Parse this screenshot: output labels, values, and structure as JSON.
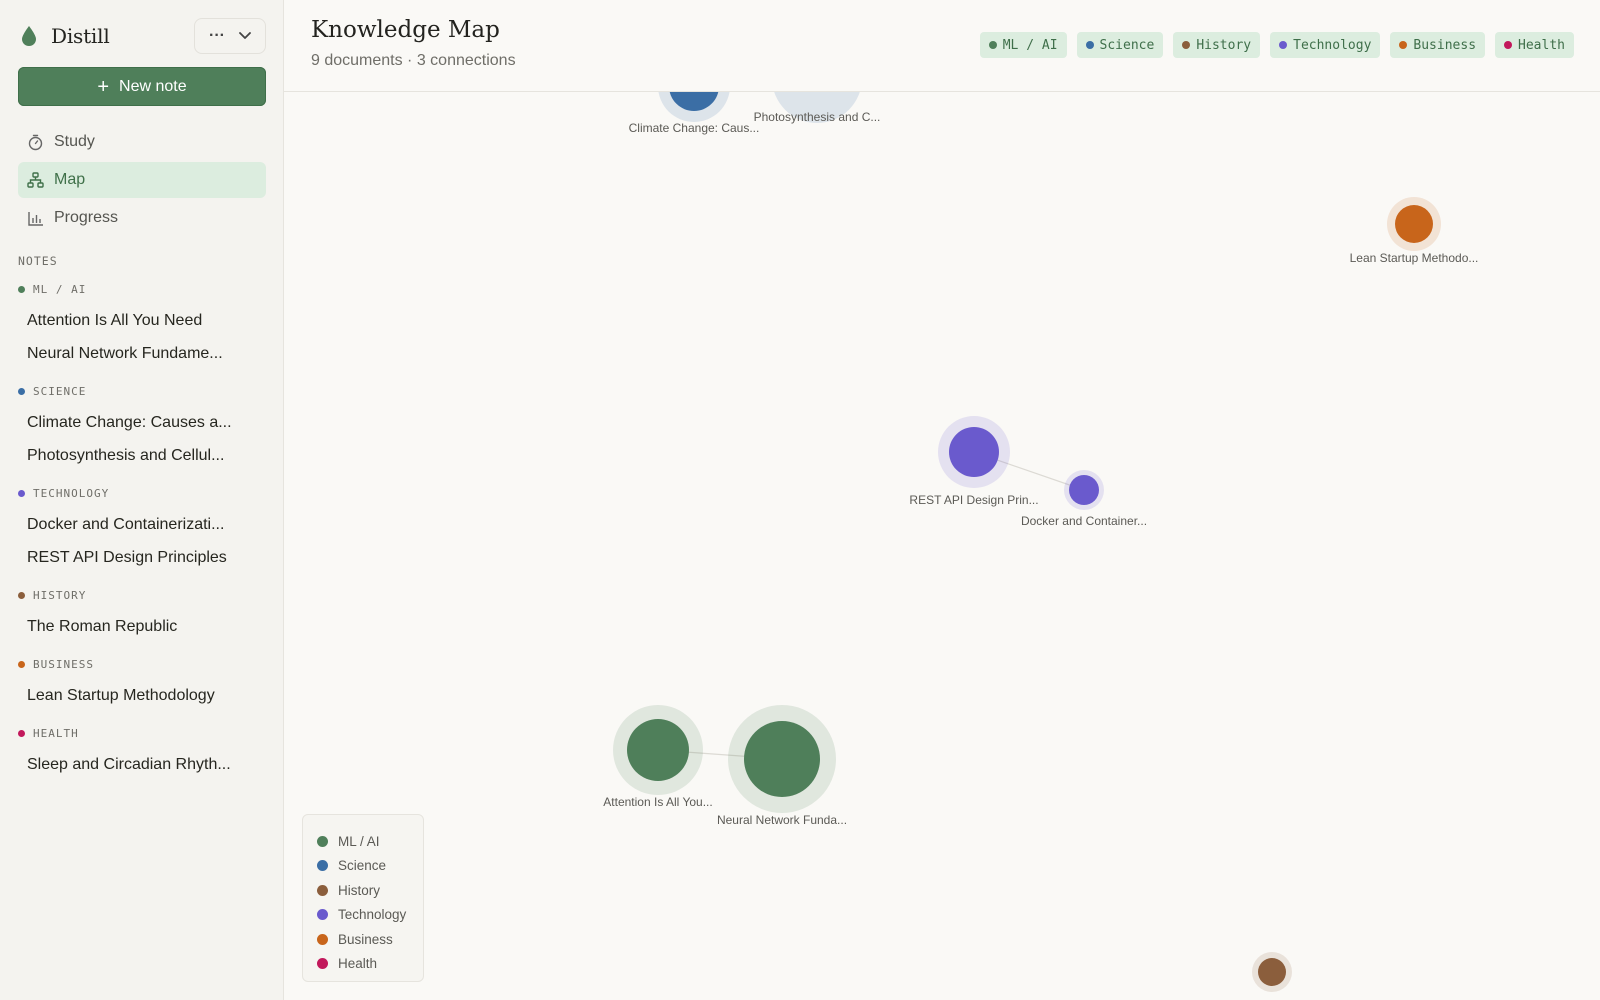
{
  "app": {
    "name": "Distill"
  },
  "sidebar": {
    "new_note_label": "New note",
    "nav": [
      {
        "label": "Study",
        "icon": "timer-icon"
      },
      {
        "label": "Map",
        "icon": "graph-icon",
        "active": true
      },
      {
        "label": "Progress",
        "icon": "bar-chart-icon"
      }
    ],
    "notes_label": "NOTES",
    "groups": [
      {
        "name": "ML / AI",
        "color": "#4f7f5a",
        "items": [
          "Attention Is All You Need",
          "Neural Network Fundame..."
        ]
      },
      {
        "name": "SCIENCE",
        "color": "#3b6ea5",
        "items": [
          "Climate Change: Causes a...",
          "Photosynthesis and Cellul..."
        ]
      },
      {
        "name": "TECHNOLOGY",
        "color": "#6a5acd",
        "items": [
          "Docker and Containerizati...",
          "REST API Design Principles"
        ]
      },
      {
        "name": "HISTORY",
        "color": "#8b5e3c",
        "items": [
          "The Roman Republic"
        ]
      },
      {
        "name": "BUSINESS",
        "color": "#c8651b",
        "items": [
          "Lean Startup Methodology"
        ]
      },
      {
        "name": "HEALTH",
        "color": "#c2185b",
        "items": [
          "Sleep and Circadian Rhyth..."
        ]
      }
    ]
  },
  "header": {
    "title": "Knowledge Map",
    "subtitle": "9 documents · 3 connections",
    "filters": [
      {
        "label": "ML / AI",
        "color": "#4f7f5a"
      },
      {
        "label": "Science",
        "color": "#3b6ea5"
      },
      {
        "label": "History",
        "color": "#8b5e3c"
      },
      {
        "label": "Technology",
        "color": "#6a5acd"
      },
      {
        "label": "Business",
        "color": "#c8651b"
      },
      {
        "label": "Health",
        "color": "#c2185b"
      }
    ]
  },
  "map": {
    "nodes": [
      {
        "id": "climate",
        "label": "Climate Change: Caus...",
        "color": "#3b6ea5"
      },
      {
        "id": "photo",
        "label": "Photosynthesis and C...",
        "color": "#3b6ea5"
      },
      {
        "id": "lean",
        "label": "Lean Startup Methodo...",
        "color": "#c8651b"
      },
      {
        "id": "rest",
        "label": "REST API Design Prin...",
        "color": "#6a5acd"
      },
      {
        "id": "docker",
        "label": "Docker and Container...",
        "color": "#6a5acd"
      },
      {
        "id": "attention",
        "label": "Attention Is All You...",
        "color": "#4f7f5a"
      },
      {
        "id": "neural",
        "label": "Neural Network Funda...",
        "color": "#4f7f5a"
      },
      {
        "id": "roman",
        "label": "The Roman Republic",
        "color": "#8b5e3c"
      }
    ],
    "edges": [
      [
        "rest",
        "docker"
      ],
      [
        "attention",
        "neural"
      ],
      [
        "climate",
        "photo"
      ]
    ]
  },
  "legend": [
    {
      "label": "ML / AI",
      "color": "#4f7f5a"
    },
    {
      "label": "Science",
      "color": "#3b6ea5"
    },
    {
      "label": "History",
      "color": "#8b5e3c"
    },
    {
      "label": "Technology",
      "color": "#6a5acd"
    },
    {
      "label": "Business",
      "color": "#c8651b"
    },
    {
      "label": "Health",
      "color": "#c2185b"
    }
  ]
}
